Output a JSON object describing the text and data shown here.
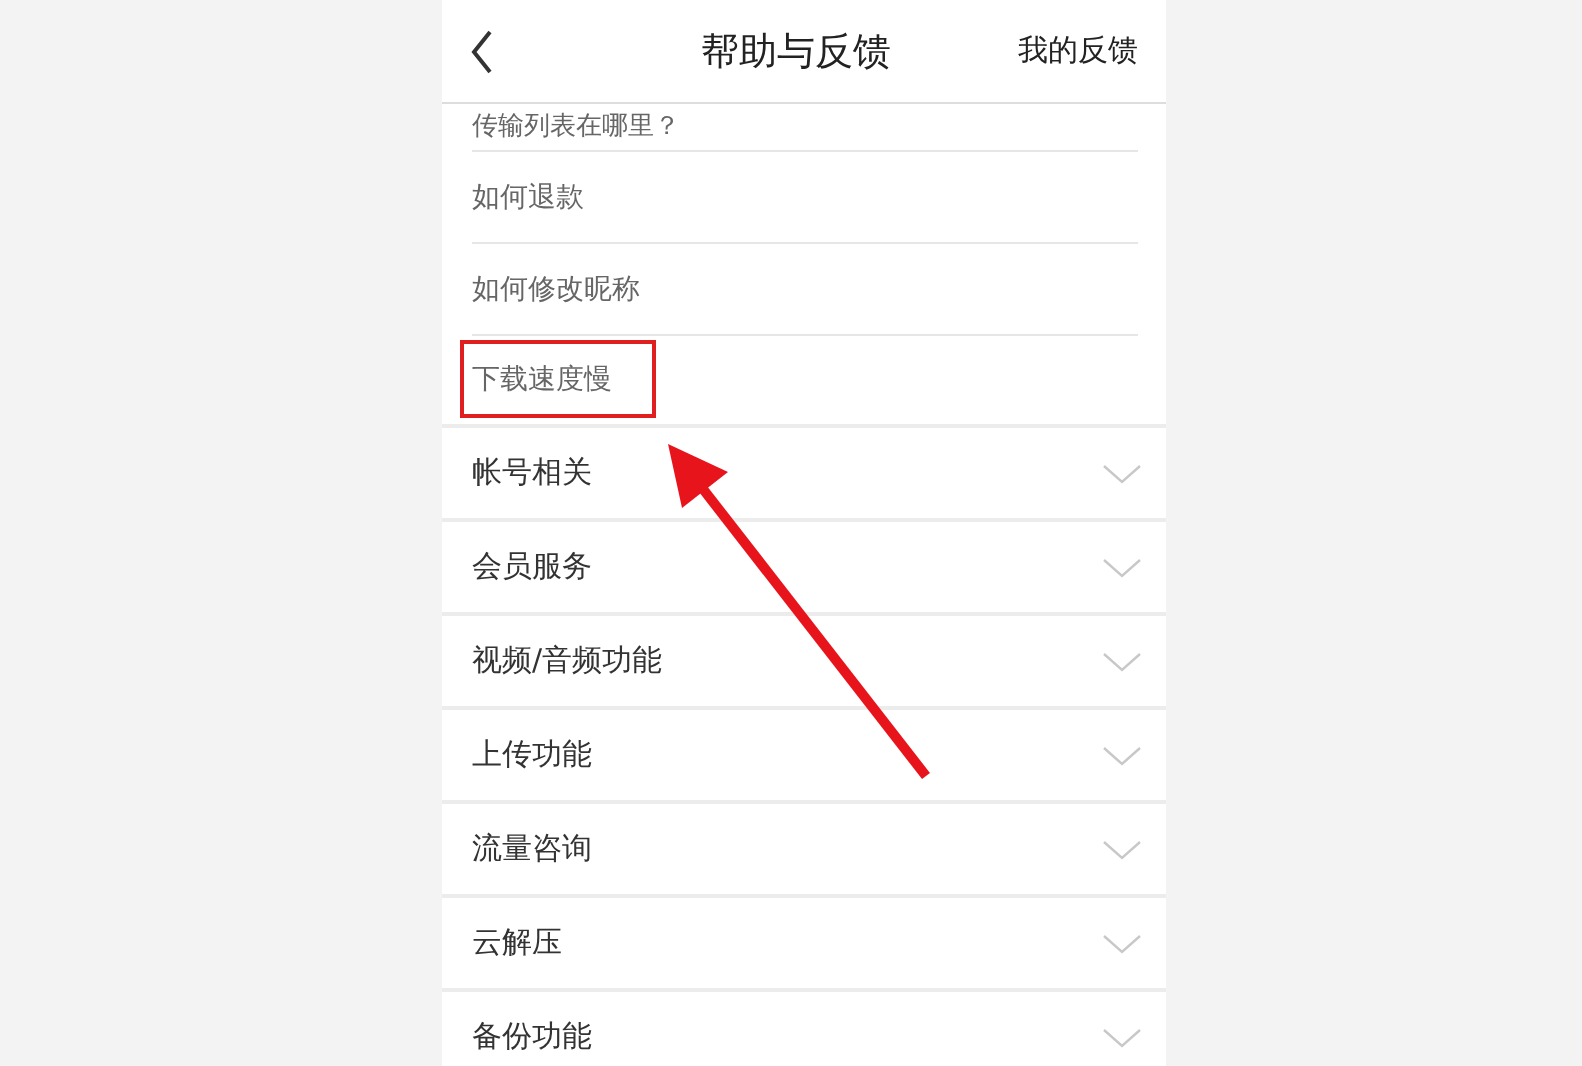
{
  "header": {
    "title": "帮助与反馈",
    "action": "我的反馈"
  },
  "expanded_items": [
    "传输列表在哪里？",
    "如何退款",
    "如何修改昵称",
    "下载速度慢"
  ],
  "categories": [
    {
      "label": "帐号相关"
    },
    {
      "label": "会员服务"
    },
    {
      "label": "视频/音频功能"
    },
    {
      "label": "上传功能"
    },
    {
      "label": "流量咨询"
    },
    {
      "label": "云解压"
    },
    {
      "label": "备份功能"
    }
  ]
}
